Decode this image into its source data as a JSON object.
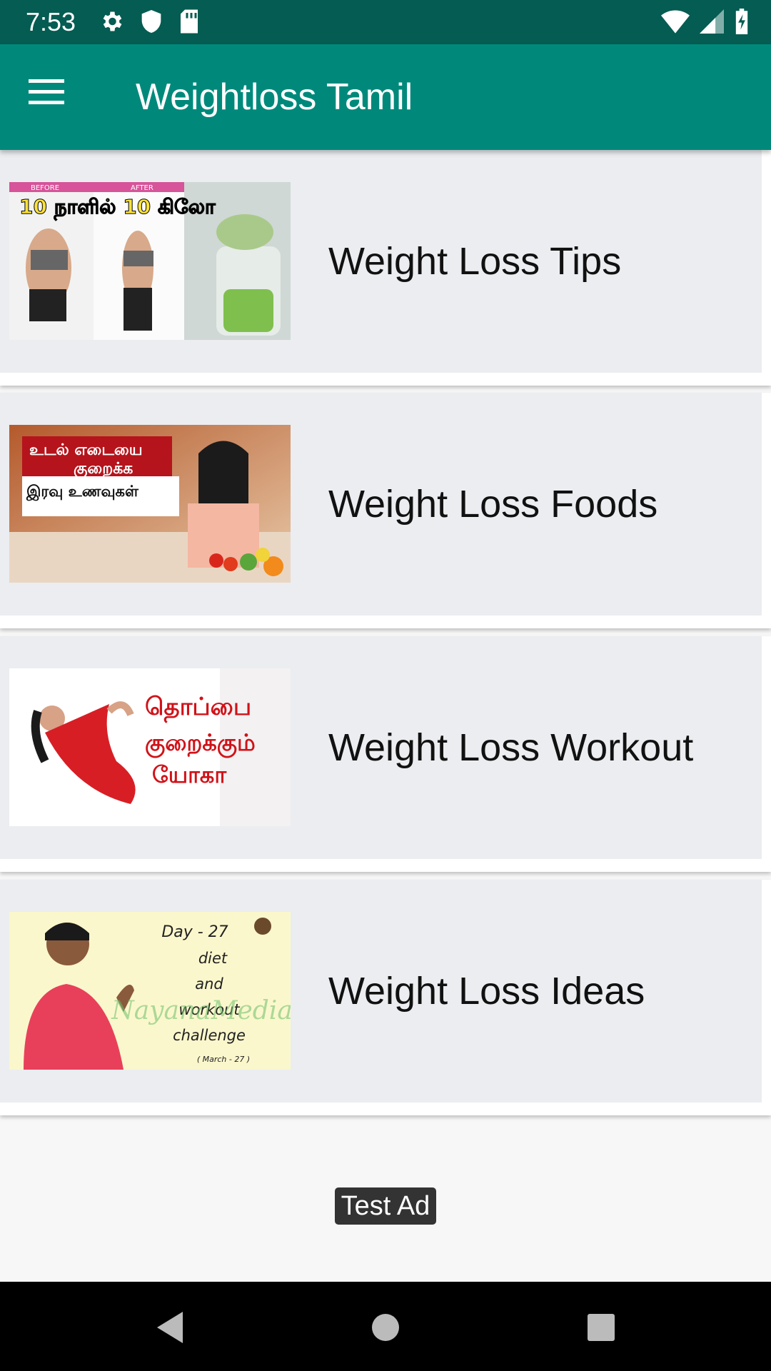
{
  "status_bar": {
    "time": "7:53",
    "icons_left": [
      "gear-icon",
      "shield-icon",
      "sd-card-icon"
    ],
    "icons_right": [
      "wifi-icon",
      "signal-icon",
      "battery-icon"
    ]
  },
  "app_bar": {
    "title": "Weightloss Tamil",
    "menu_icon": "hamburger-menu-icon",
    "color": "#00897b"
  },
  "items": [
    {
      "label": "Weight Loss Tips",
      "thumb": {
        "before": "BEFORE",
        "after": "AFTER",
        "caption": "10 நாளில் 10 கிலோ"
      }
    },
    {
      "label": "Weight Loss Foods",
      "thumb": {
        "caption_lines": [
          "உடல் எடையை",
          "குறைக்க",
          "இரவு உணவுகள்"
        ]
      }
    },
    {
      "label": "Weight Loss Workout",
      "thumb": {
        "caption_lines": [
          "தொப்பை",
          "குறைக்கும்",
          "யோகா"
        ]
      }
    },
    {
      "label": "Weight Loss Ideas",
      "thumb": {
        "caption_lines": [
          "Day - 27",
          "diet",
          "and",
          "workout",
          "challenge"
        ],
        "date": "( March - 27 )",
        "watermark": "NayanaMedia"
      }
    }
  ],
  "ad": {
    "label": "Test Ad"
  },
  "nav_bar": {
    "buttons": [
      "back-icon",
      "home-icon",
      "recents-icon"
    ]
  }
}
